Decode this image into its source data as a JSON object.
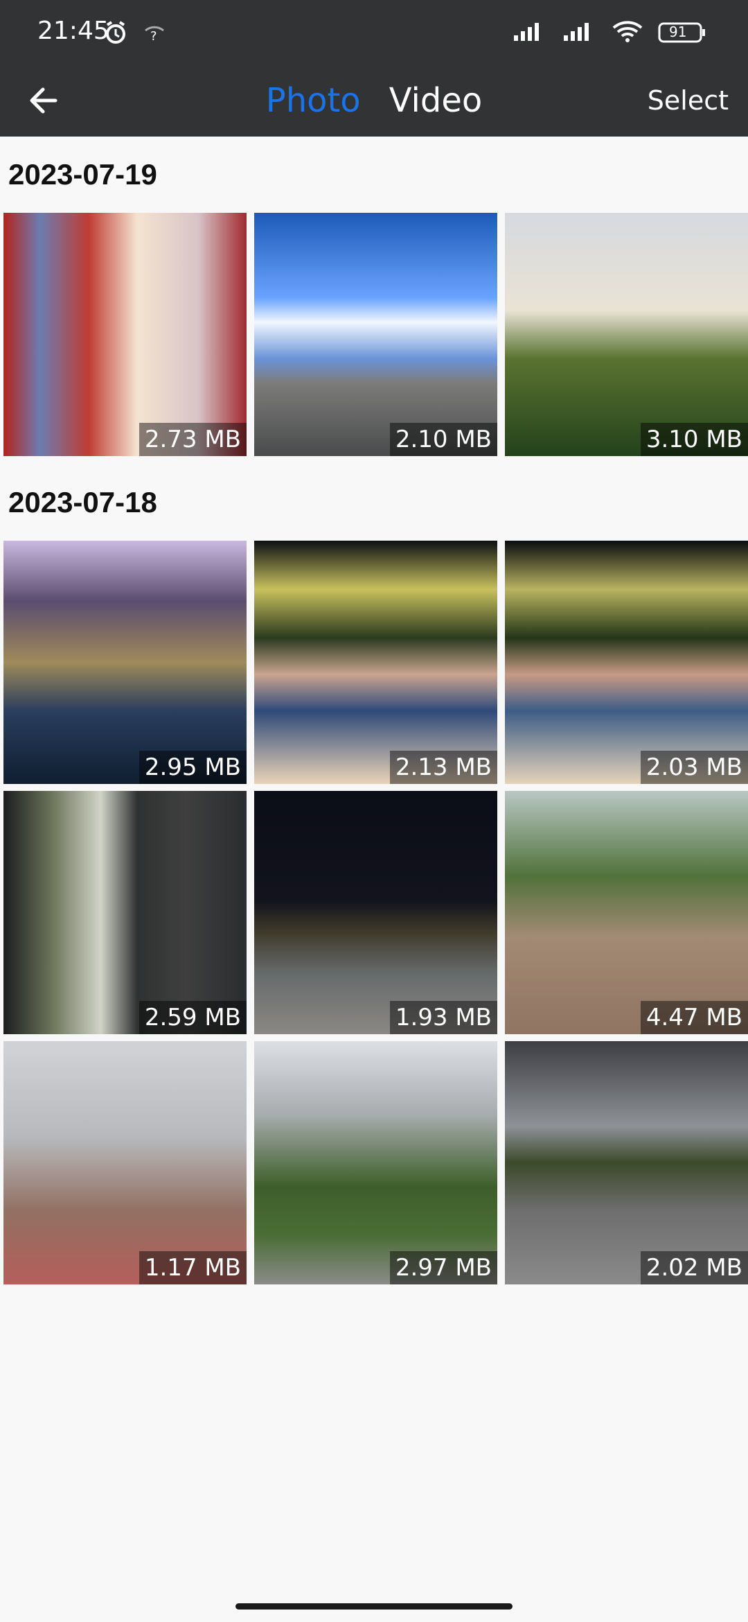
{
  "status_bar": {
    "time": "21:45",
    "battery": "91"
  },
  "top_bar": {
    "tabs": [
      {
        "label": "Photo",
        "active": true
      },
      {
        "label": "Video",
        "active": false
      }
    ],
    "select_label": "Select"
  },
  "sections": [
    {
      "date": "2023-07-19",
      "items": [
        {
          "size": "2.73 MB"
        },
        {
          "size": "2.10 MB"
        },
        {
          "size": "3.10 MB"
        }
      ]
    },
    {
      "date": "2023-07-18",
      "items": [
        {
          "size": "2.95 MB"
        },
        {
          "size": "2.13 MB"
        },
        {
          "size": "2.03 MB"
        },
        {
          "size": "2.59 MB"
        },
        {
          "size": "1.93 MB"
        },
        {
          "size": "4.47 MB"
        },
        {
          "size": "1.17 MB"
        },
        {
          "size": "2.97 MB"
        },
        {
          "size": "2.02 MB"
        }
      ]
    }
  ],
  "colors": {
    "header_bg": "#323335",
    "accent": "#1a73e8"
  },
  "icons": [
    "alarm-icon",
    "network-unknown-icon",
    "signal-icon",
    "wifi-icon",
    "battery-icon",
    "back-arrow-icon"
  ]
}
